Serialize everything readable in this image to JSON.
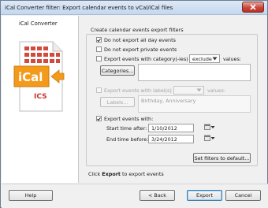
{
  "window": {
    "title": "iCal Converter filter: Export calendar events to vCal/iCal files"
  },
  "left_panel": {
    "app_name": "iCal Converter",
    "graphic_banner": "iCal",
    "graphic_ext": "ICS"
  },
  "filters": {
    "group_title": "Create calendar events export filters",
    "no_all_day": {
      "label": "Do not export all day events",
      "checked": true
    },
    "no_private": {
      "label": "Do not export private events",
      "checked": false
    },
    "category": {
      "label": "Export events with category(-ies) that",
      "mode": "exclude",
      "values_label": "values:",
      "button": "Categories...",
      "value": ""
    },
    "labels": {
      "label": "Export events with label(s) that",
      "mode": "",
      "values_label": "values:",
      "button": "Labels...",
      "value": "Birthday, Anniversary"
    },
    "dates": {
      "label": "Export events with:",
      "start_label": "Start time after:",
      "start_value": "1/10/2012",
      "end_label": "End time before:",
      "end_value": "3/24/2012"
    },
    "default_button": "Set filters to default..."
  },
  "hint": {
    "prefix": "Click ",
    "bold": "Export",
    "suffix": " to export events"
  },
  "footer": {
    "help": "Help",
    "back": "< Back",
    "export": "Export",
    "cancel": "Cancel"
  },
  "colors": {
    "accent_orange": "#f39a1b",
    "ical_red": "#c8342a",
    "title_gradient_top": "#dce9f7"
  }
}
